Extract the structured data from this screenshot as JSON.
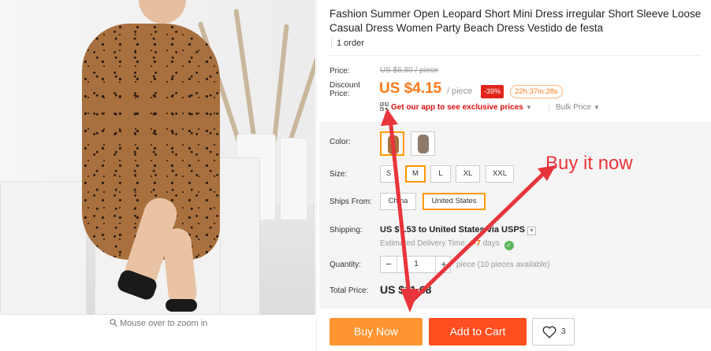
{
  "product": {
    "title": "Fashion Summer Open Leopard Short Mini Dress irregular Short Sleeve Loose Casual Dress Women Party Beach Dress Vestido de festa",
    "orders": "1 order",
    "zoom_hint": "Mouse over to zoom in"
  },
  "pricing": {
    "price_label": "Price:",
    "original_price": "US $6.80 / piece",
    "discount_label_line1": "Discount",
    "discount_label_line2": "Price:",
    "discount_price": "US $4.15",
    "per_piece": "/ piece",
    "discount_badge": "-39%",
    "countdown": "22h:37m:28s",
    "app_promo": "Get our app to see exclusive prices",
    "bulk_price": "Bulk Price"
  },
  "options": {
    "color_label": "Color:",
    "size_label": "Size:",
    "sizes": [
      "S",
      "M",
      "L",
      "XL",
      "XXL"
    ],
    "selected_size": "M",
    "ships_from_label": "Ships From:",
    "ships_from": [
      "China",
      "United States"
    ],
    "selected_ships_from": "United States"
  },
  "shipping": {
    "label": "Shipping:",
    "summary": "US $7.53 to United States via USPS",
    "delivery_prefix": "Estimated Delivery Time:",
    "delivery_days": "4-7",
    "delivery_suffix": "days"
  },
  "quantity": {
    "label": "Quantity:",
    "minus": "−",
    "value": "1",
    "plus": "+",
    "available": "piece (10 pieces available)"
  },
  "total": {
    "label": "Total Price:",
    "value": "US $11.68"
  },
  "actions": {
    "buy_now": "Buy Now",
    "add_to_cart": "Add to Cart",
    "wishlist_count": "3"
  },
  "annotation": {
    "text": "Buy it now",
    "color": "#e8343b"
  },
  "colors": {
    "price_orange": "#ff7a1a",
    "buy_now_bg": "#ff9531",
    "add_to_cart_bg": "#ff4e1f",
    "selected_border": "#ff9900",
    "discount_badge_bg": "#e1251b"
  },
  "icons": [
    "magnifier-icon",
    "qr-code-icon",
    "chevron-down-icon",
    "check-circle-icon",
    "heart-icon"
  ]
}
